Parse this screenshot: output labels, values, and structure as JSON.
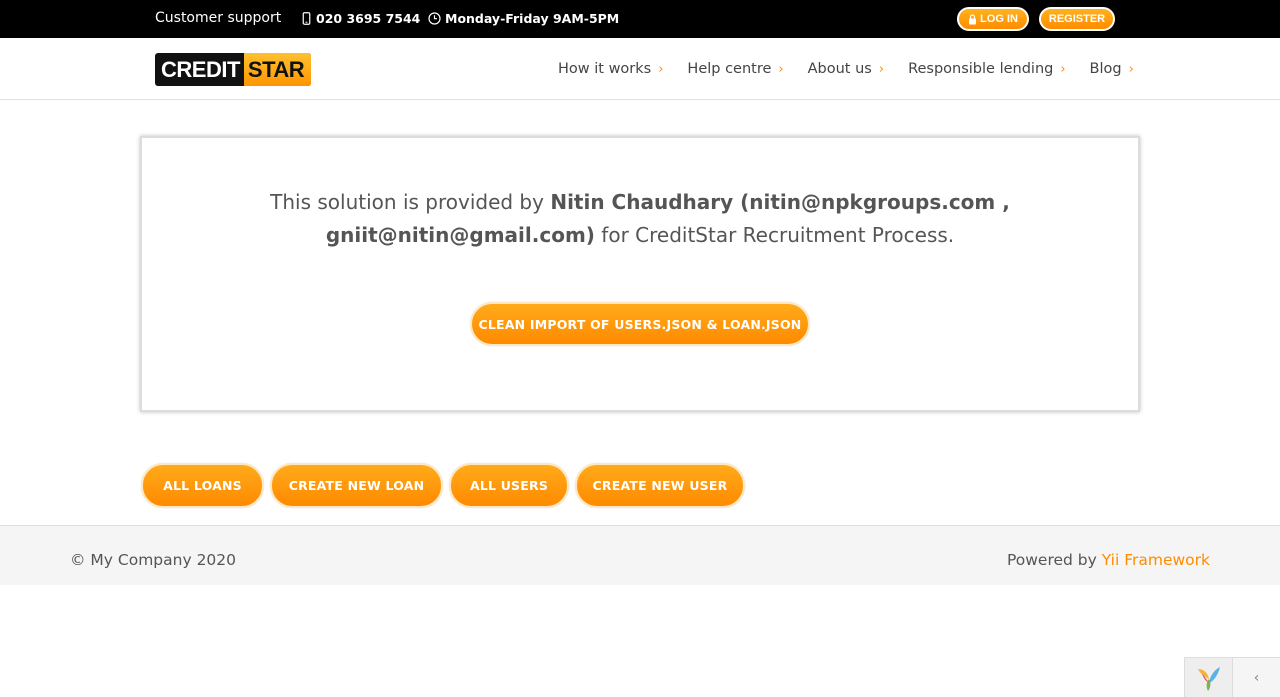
{
  "topbar": {
    "support_label": "Customer support",
    "phone": "020 3695 7544",
    "hours": "Monday-Friday 9AM-5PM",
    "login_label": "LOG IN",
    "register_label": "REGISTER",
    "icons": [
      "mobile-phone-icon",
      "clock-icon",
      "lock-icon"
    ]
  },
  "header": {
    "logo_part1": "CREDIT",
    "logo_part2": "STAR",
    "nav": [
      {
        "label": "How it works"
      },
      {
        "label": "Help centre"
      },
      {
        "label": "About us"
      },
      {
        "label": "Responsible lending"
      },
      {
        "label": "Blog"
      }
    ],
    "nav_chevron": "›"
  },
  "card": {
    "intro": "This solution is provided by",
    "author": "Nitin Chaudhary (nitin@npkgroups.com , gniit@nitin@gmail.com)",
    "outro": "for CreditStar Recruitment Process.",
    "import_button": "CLEAN IMPORT OF USERS.JSON & LOAN.JSON"
  },
  "actions": {
    "all_loans": "ALL LOANS",
    "create_loan": "CREATE NEW LOAN",
    "all_users": "ALL USERS",
    "create_user": "CREATE NEW USER"
  },
  "footer": {
    "copyright": "© My Company 2020",
    "powered_prefix": "Powered by",
    "powered_link": "Yii Framework"
  },
  "debugbar": {
    "toggle_glyph": "‹"
  },
  "colors": {
    "accent": "#ff8c00",
    "topbar_bg": "#000000",
    "footer_bg": "#f5f5f5"
  }
}
